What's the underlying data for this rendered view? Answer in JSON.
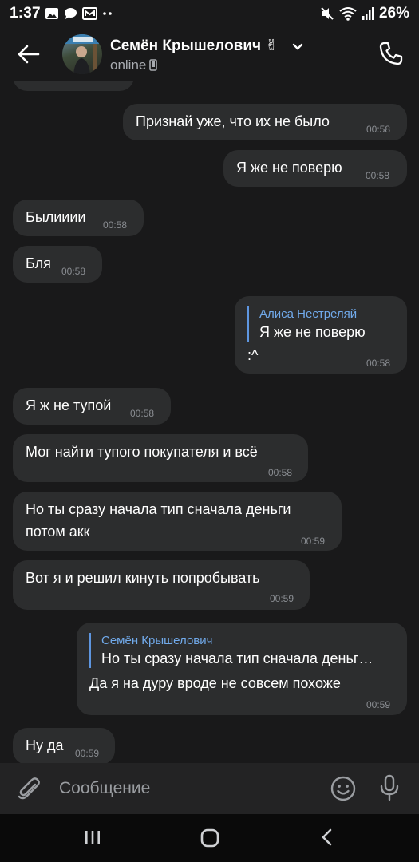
{
  "status_bar": {
    "time": "1:37",
    "battery": "26%",
    "icons_left": [
      "gallery-icon",
      "chat-bubble-icon",
      "mail-icon",
      "more-dots-icon"
    ],
    "icons_right": [
      "mute-icon",
      "wifi-icon",
      "signal-icon"
    ]
  },
  "header": {
    "contact_name": "Семён Крышелович ✌",
    "status": "online",
    "icons": [
      "back-arrow-icon",
      "chevron-down-icon",
      "mobile-device-icon",
      "phone-icon"
    ]
  },
  "messages": [
    {
      "id": "m1",
      "side": "out",
      "text": "Признай уже, что их не было",
      "time": "00:58"
    },
    {
      "id": "m2",
      "side": "out",
      "text": "Я же не поверю",
      "time": "00:58"
    },
    {
      "id": "m3",
      "side": "in",
      "text": "Былииии",
      "time": "00:58"
    },
    {
      "id": "m4",
      "side": "in",
      "text": "Бля",
      "time": "00:58"
    },
    {
      "id": "m5",
      "side": "out",
      "reply": {
        "author": "Алиса Нестреляй",
        "text": "Я же не поверю"
      },
      "text": ":^",
      "time": "00:58"
    },
    {
      "id": "m6",
      "side": "in",
      "text": "Я ж не тупой",
      "time": "00:58"
    },
    {
      "id": "m7",
      "side": "in",
      "text": "Мог найти тупого покупателя и всё",
      "time": "00:58"
    },
    {
      "id": "m8",
      "side": "in",
      "lines": [
        "Но ты сразу начала тип сначала деньги",
        "потом акк"
      ],
      "time": "00:59"
    },
    {
      "id": "m9",
      "side": "in",
      "text": "Вот я и решил кинуть попробывать",
      "time": "00:59"
    },
    {
      "id": "m10",
      "side": "out",
      "reply": {
        "author": "Семён Крышелович",
        "text": "Но ты сразу начала тип сначала деньг…"
      },
      "text": "Да я на дуру вроде не совсем похоже",
      "time": "00:59"
    },
    {
      "id": "m11",
      "side": "in",
      "text": "Ну да",
      "time": "00:59"
    }
  ],
  "composer": {
    "placeholder": "Сообщение",
    "icons": [
      "paperclip-icon",
      "emoji-icon",
      "microphone-icon"
    ]
  },
  "nav_bar": {
    "icons": [
      "recent-apps-icon",
      "home-icon",
      "back-icon"
    ]
  },
  "colors": {
    "background": "#19191a",
    "bubble": "#2c2d2e",
    "accent": "#71aaeb",
    "time_text": "#8a8d92"
  }
}
